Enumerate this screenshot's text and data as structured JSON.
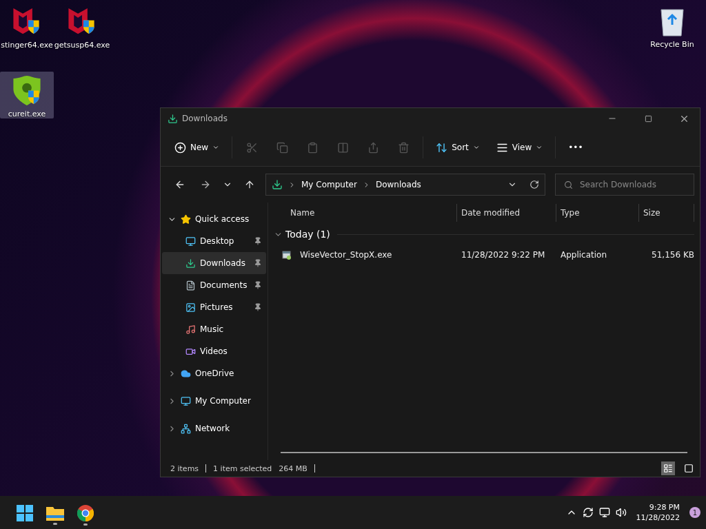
{
  "desktop_icons": [
    {
      "label": "stinger64.exe",
      "kind": "mcafee",
      "selected": false
    },
    {
      "label": "getsusp64.exe",
      "kind": "mcafee",
      "selected": false
    },
    {
      "label": "Recycle Bin",
      "kind": "recycle",
      "selected": false
    },
    {
      "label": "cureit.exe",
      "kind": "drweb",
      "selected": true
    }
  ],
  "window": {
    "title": "Downloads",
    "toolbar": {
      "new_label": "New",
      "sort_label": "Sort",
      "view_label": "View",
      "more": "•••"
    },
    "address": {
      "crumbs": [
        "My Computer",
        "Downloads"
      ]
    },
    "search": {
      "placeholder": "Search Downloads"
    },
    "sidebar": {
      "items": [
        {
          "label": "Quick access",
          "kind": "star",
          "expanded": true,
          "selected": false,
          "children": [
            {
              "label": "Desktop",
              "kind": "desktop",
              "pinned": true,
              "selected": false
            },
            {
              "label": "Downloads",
              "kind": "download",
              "pinned": true,
              "selected": true
            },
            {
              "label": "Documents",
              "kind": "document",
              "pinned": true,
              "selected": false
            },
            {
              "label": "Pictures",
              "kind": "pictures",
              "pinned": true,
              "selected": false
            },
            {
              "label": "Music",
              "kind": "music",
              "pinned": false,
              "selected": false
            },
            {
              "label": "Videos",
              "kind": "videos",
              "pinned": false,
              "selected": false
            }
          ]
        },
        {
          "label": "OneDrive",
          "kind": "cloud",
          "expanded": false,
          "selected": false
        },
        {
          "label": "My Computer",
          "kind": "computer",
          "expanded": false,
          "selected": false
        },
        {
          "label": "Network",
          "kind": "network",
          "expanded": false,
          "selected": false
        }
      ]
    },
    "table": {
      "columns": [
        "Name",
        "Date modified",
        "Type",
        "Size"
      ],
      "groups": [
        {
          "label": "Today (1)",
          "expanded": true,
          "rows": [
            {
              "name": "WiseVector_StopX.exe",
              "date": "11/28/2022 9:22 PM",
              "type": "Application",
              "size": "51,156 KB",
              "selected": false
            }
          ]
        }
      ]
    },
    "status_bar": {
      "items": "2 items",
      "selection": "1 item selected",
      "size": "264 MB",
      "views": [
        {
          "kind": "details",
          "selected": true
        },
        {
          "kind": "tiles",
          "selected": false
        }
      ]
    }
  },
  "taskbar": {
    "apps": [
      {
        "kind": "start",
        "running": false
      },
      {
        "kind": "explorer",
        "running": true
      },
      {
        "kind": "chrome",
        "running": true
      }
    ],
    "time": "9:28 PM",
    "date": "11/28/2022",
    "notifications": "1"
  }
}
